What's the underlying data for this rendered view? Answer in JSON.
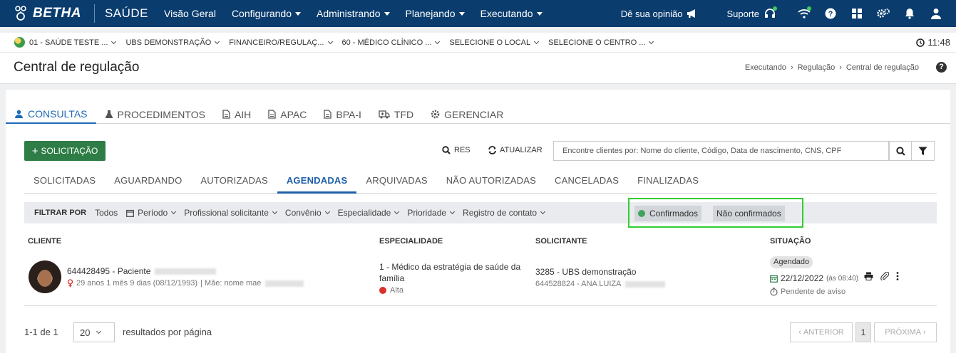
{
  "brand": {
    "name": "BETHA",
    "product": "SAÚDE"
  },
  "topnav": {
    "items": [
      {
        "label": "Visão Geral"
      },
      {
        "label": "Configurando"
      },
      {
        "label": "Administrando"
      },
      {
        "label": "Planejando"
      },
      {
        "label": "Executando"
      }
    ],
    "opinion": "Dê sua opinião",
    "support": "Suporte"
  },
  "context": {
    "items": [
      "01 - SAÚDE TESTE ...",
      "UBS DEMONSTRAÇÃO",
      "FINANCEIRO/REGULAÇ...",
      "60 - MÉDICO CLÍNICO ...",
      "SELECIONE O LOCAL",
      "SELECIONE O CENTRO ..."
    ],
    "time": "11:48"
  },
  "page": {
    "title": "Central de regulação",
    "breadcrumb": [
      "Executando",
      "Regulação",
      "Central de regulação"
    ]
  },
  "module_tabs": [
    {
      "label": "CONSULTAS",
      "icon": "users-icon",
      "active": true
    },
    {
      "label": "PROCEDIMENTOS",
      "icon": "flask-icon"
    },
    {
      "label": "AIH",
      "icon": "document-icon"
    },
    {
      "label": "APAC",
      "icon": "document-icon"
    },
    {
      "label": "BPA-I",
      "icon": "document-icon"
    },
    {
      "label": "TFD",
      "icon": "ambulance-icon"
    },
    {
      "label": "GERENCIAR",
      "icon": "gear-icon"
    }
  ],
  "toolbar": {
    "new_label": "SOLICITAÇÃO",
    "res_label": "RES",
    "refresh_label": "ATUALIZAR",
    "search_placeholder": "Encontre clientes por: Nome do cliente, Código, Data de nascimento, CNS, CPF"
  },
  "status_tabs": [
    {
      "label": "SOLICITADAS"
    },
    {
      "label": "AGUARDANDO"
    },
    {
      "label": "AUTORIZADAS"
    },
    {
      "label": "AGENDADAS",
      "active": true
    },
    {
      "label": "ARQUIVADAS"
    },
    {
      "label": "NÃO AUTORIZADAS"
    },
    {
      "label": "CANCELADAS"
    },
    {
      "label": "FINALIZADAS"
    }
  ],
  "filter": {
    "label": "FILTRAR POR",
    "items": [
      "Todos",
      "Período",
      "Profissional solicitante",
      "Convênio",
      "Especialidade",
      "Prioridade",
      "Registro de contato"
    ],
    "confirmed": "Confirmados",
    "not_confirmed": "Não confirmados",
    "confirmed_color": "#41a459",
    "highlight_color": "#32cd32"
  },
  "table": {
    "headers": [
      "CLIENTE",
      "ESPECIALIDADE",
      "SOLICITANTE",
      "SITUAÇÃO"
    ],
    "rows": [
      {
        "patient": "644428495 - Paciente",
        "meta_age": "29 anos 1 mês 9 dias (08/12/1993)",
        "meta_mother": "| Mãe: nome mae",
        "specialty": "1 - Médico da estratégia de saúde da família",
        "priority": "Alta",
        "priority_color": "#d9332b",
        "requester": "3285 - UBS demonstração",
        "professional": "644528824 - ANA LUIZA",
        "status": "Agendado",
        "date": "22/12/2022",
        "time": "(às 08:40)",
        "notice": "Pendente de aviso"
      }
    ]
  },
  "pagination": {
    "count": "1-1 de 1",
    "page_size": "20",
    "results_label": "resultados por página",
    "prev": "ANTERIOR",
    "page": "1",
    "next": "PRÓXIMA"
  }
}
